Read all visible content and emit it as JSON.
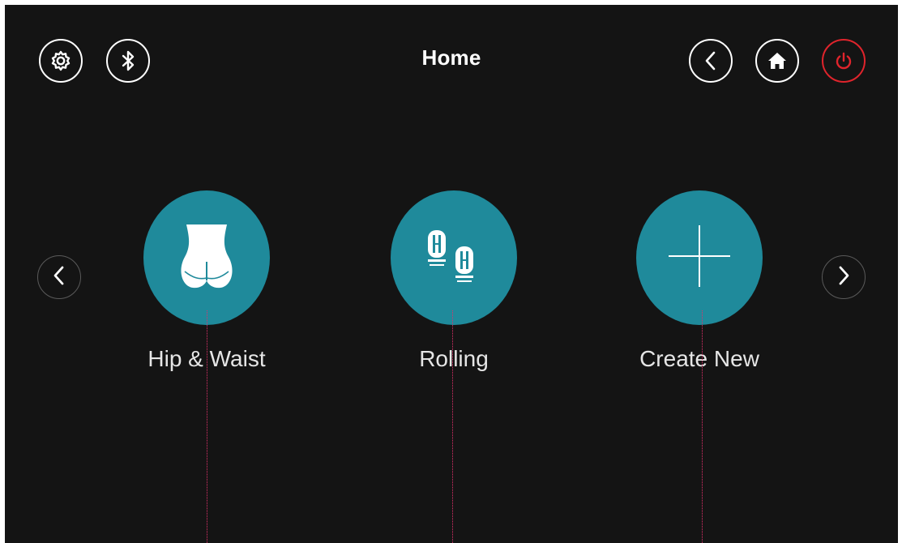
{
  "header": {
    "title": "Home",
    "settings_icon": "gear-icon",
    "bluetooth_icon": "bluetooth-icon",
    "back_icon": "chevron-left-icon",
    "home_icon": "home-icon",
    "power_icon": "power-icon"
  },
  "carousel": {
    "prev_icon": "chevron-left-icon",
    "next_icon": "chevron-right-icon",
    "programs": [
      {
        "label": "Hip & Waist",
        "icon": "hip-waist-icon"
      },
      {
        "label": "Rolling",
        "icon": "rolling-icon"
      },
      {
        "label": "Create New",
        "icon": "plus-icon"
      }
    ]
  },
  "colors": {
    "background": "#141414",
    "accent": "#1f8a9b",
    "power": "#e0242c",
    "text": "#ffffff",
    "guide": "#e0306a"
  }
}
